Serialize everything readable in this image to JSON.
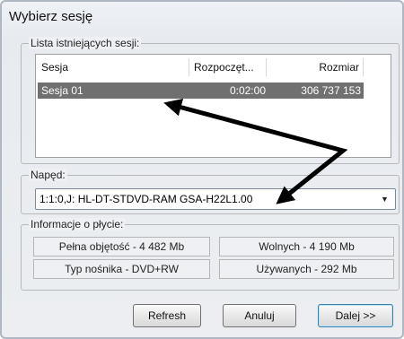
{
  "dialog": {
    "title": "Wybierz sesję"
  },
  "sessions": {
    "legend": "Lista istniejących sesji:",
    "columns": {
      "session": "Sesja",
      "started": "Rozpoczęt...",
      "size": "Rozmiar"
    },
    "rows": [
      {
        "session": "Sesja 01",
        "started": "0:02:00",
        "size": "306 737 153",
        "selected": true
      }
    ]
  },
  "drive": {
    "legend": "Napęd:",
    "selected": "1:1:0,J: HL-DT-STDVD-RAM GSA-H22L1.00"
  },
  "disc_info": {
    "legend": "Informacje o płycie:",
    "total": "Pełna objętość - 4 482 Mb",
    "free": "Wolnych - 4 190 Mb",
    "media_type": "Typ nośnika - DVD+RW",
    "used": "Używanych - 292 Mb"
  },
  "buttons": {
    "refresh": "Refresh",
    "cancel": "Anuluj",
    "next": "Dalej >>"
  },
  "colors": {
    "selection": "#707070",
    "arrow": "#000000"
  }
}
